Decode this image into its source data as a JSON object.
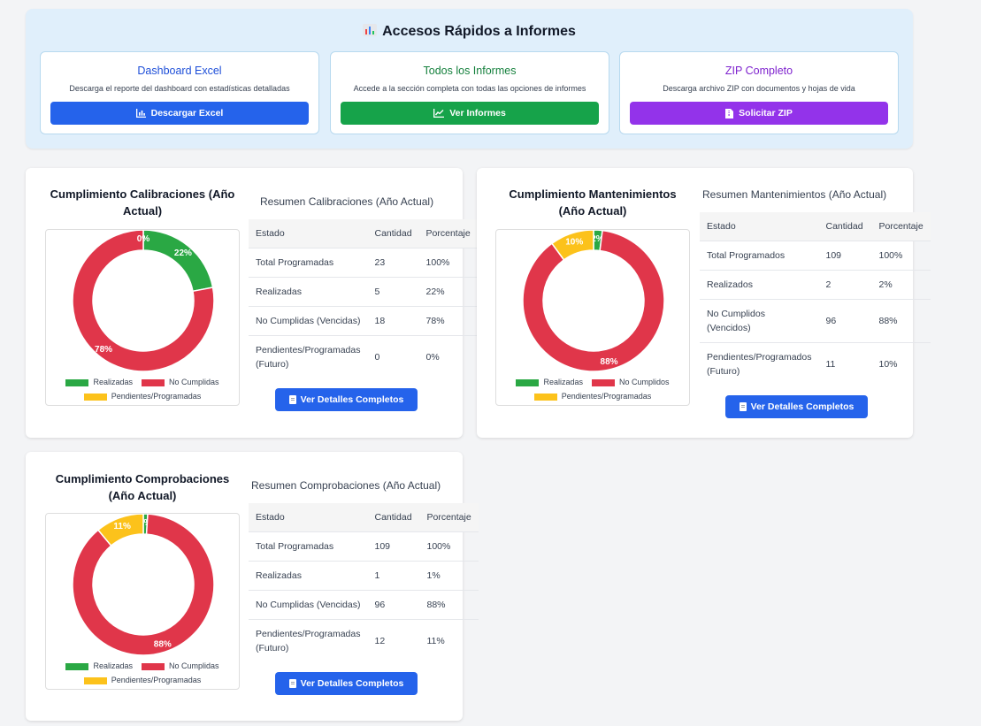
{
  "colors": {
    "green": "#2aa844",
    "red": "#e0364a",
    "yellow": "#fcc21b",
    "blue": "#2563eb",
    "tealbtn": "#16a34a",
    "purple": "#9333ea"
  },
  "quick_access": {
    "title": "Accesos Rápidos a Informes",
    "icon": "bar-chart-icon",
    "cards": [
      {
        "title": "Dashboard Excel",
        "desc": "Descarga el reporte del dashboard con estadísticas detalladas",
        "button": "Descargar Excel",
        "icon": "chart-bars-icon",
        "color": "#2563eb"
      },
      {
        "title": "Todos los Informes",
        "desc": "Accede a la sección completa con todas las opciones de informes",
        "button": "Ver Informes",
        "icon": "line-chart-icon",
        "color": "#16a34a"
      },
      {
        "title": "ZIP Completo",
        "desc": "Descarga archivo ZIP con documentos y hojas de vida",
        "button": "Solicitar ZIP",
        "icon": "zip-file-icon",
        "color": "#9333ea"
      }
    ]
  },
  "legend": {
    "realizadas": "Realizadas",
    "pendientes": "Pendientes/Programadas"
  },
  "headers": {
    "estado": "Estado",
    "cantidad": "Cantidad",
    "porcentaje": "Porcentaje"
  },
  "details_button": "Ver Detalles Completos",
  "sections": [
    {
      "title": "Cumplimiento Calibraciones (Año Actual)",
      "summary_title": "Resumen Calibraciones (Año Actual)",
      "legend_no": "No Cumplidas",
      "rows": [
        {
          "estado": "Total Programadas",
          "cantidad": "23",
          "porcentaje": "100%"
        },
        {
          "estado": "Realizadas",
          "cantidad": "5",
          "porcentaje": "22%"
        },
        {
          "estado": "No Cumplidas (Vencidas)",
          "cantidad": "18",
          "porcentaje": "78%"
        },
        {
          "estado": "Pendientes/Programadas (Futuro)",
          "cantidad": "0",
          "porcentaje": "0%"
        }
      ],
      "chart_data": {
        "type": "pie",
        "categories": [
          "Realizadas",
          "No Cumplidas",
          "Pendientes/Programadas"
        ],
        "values": [
          22,
          78,
          0
        ],
        "labels": [
          "22%",
          "78%",
          "0%"
        ]
      }
    },
    {
      "title": "Cumplimiento Mantenimientos (Año Actual)",
      "summary_title": "Resumen Mantenimientos (Año Actual)",
      "legend_no": "No Cumplidos",
      "rows": [
        {
          "estado": "Total Programados",
          "cantidad": "109",
          "porcentaje": "100%"
        },
        {
          "estado": "Realizados",
          "cantidad": "2",
          "porcentaje": "2%"
        },
        {
          "estado": "No Cumplidos (Vencidos)",
          "cantidad": "96",
          "porcentaje": "88%"
        },
        {
          "estado": "Pendientes/Programados (Futuro)",
          "cantidad": "11",
          "porcentaje": "10%"
        }
      ],
      "chart_data": {
        "type": "pie",
        "categories": [
          "Realizados",
          "No Cumplidos",
          "Pendientes/Programados"
        ],
        "values": [
          2,
          88,
          10
        ],
        "labels": [
          "2%",
          "88%",
          "10%"
        ]
      }
    },
    {
      "title": "Cumplimiento Comprobaciones (Año Actual)",
      "summary_title": "Resumen Comprobaciones (Año Actual)",
      "legend_no": "No Cumplidas",
      "rows": [
        {
          "estado": "Total Programadas",
          "cantidad": "109",
          "porcentaje": "100%"
        },
        {
          "estado": "Realizadas",
          "cantidad": "1",
          "porcentaje": "1%"
        },
        {
          "estado": "No Cumplidas (Vencidas)",
          "cantidad": "96",
          "porcentaje": "88%"
        },
        {
          "estado": "Pendientes/Programadas (Futuro)",
          "cantidad": "12",
          "porcentaje": "11%"
        }
      ],
      "chart_data": {
        "type": "pie",
        "categories": [
          "Realizadas",
          "No Cumplidas",
          "Pendientes/Programadas"
        ],
        "values": [
          1,
          88,
          11
        ],
        "labels": [
          "1%",
          "88%",
          "11%"
        ]
      }
    }
  ]
}
